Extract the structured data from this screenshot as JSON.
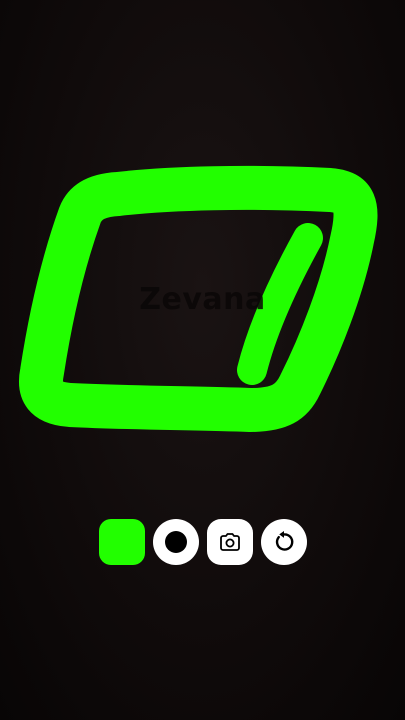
{
  "app": {
    "watermark_text": "Zevana"
  },
  "drawing": {
    "stroke_color": "#22ff00",
    "background_color": "#0d0909"
  },
  "toolbar": {
    "buttons": [
      {
        "name": "color-swatch-button",
        "icon": "color-swatch",
        "color": "#22ff00"
      },
      {
        "name": "brush-size-button",
        "icon": "brush-dot-icon"
      },
      {
        "name": "camera-button",
        "icon": "camera-icon"
      },
      {
        "name": "undo-button",
        "icon": "undo-icon"
      }
    ]
  }
}
